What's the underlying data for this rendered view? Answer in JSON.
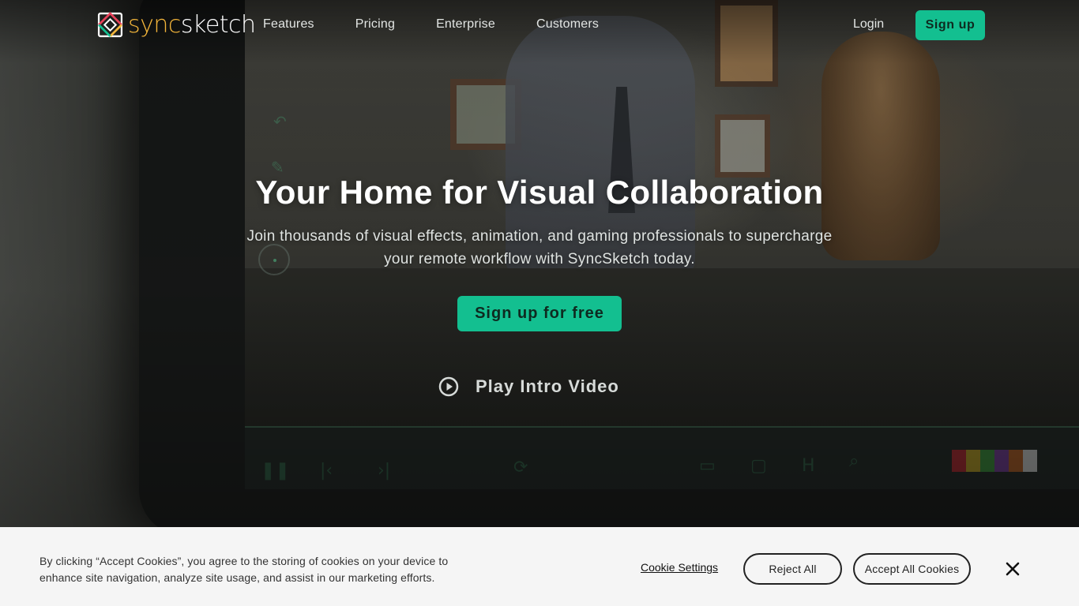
{
  "brand": {
    "name_part1": "sync",
    "name_part2": "sketch",
    "accent_color": "#13bf90",
    "logo_colors": [
      "#e8425a",
      "#f3b53a",
      "#13bf90",
      "#ffffff"
    ]
  },
  "nav": {
    "links": [
      "Features",
      "Pricing",
      "Enterprise",
      "Customers"
    ],
    "login": "Login",
    "signup": "Sign up"
  },
  "hero": {
    "title": "Your Home for Visual Collaboration",
    "subtitle": "Join thousands of visual effects, animation, and gaming professionals to supercharge your remote workflow with SyncSketch today.",
    "cta": "Sign up for free",
    "play_video": "Play Intro Video",
    "play_icon": "play-circle-icon"
  },
  "cookie_banner": {
    "message": "By clicking “Accept Cookies”, you agree to the storing of cookies on your device to enhance site navigation, analyze site usage, and assist in our marketing efforts.",
    "settings": "Cookie Settings",
    "reject": "Reject All",
    "accept": "Accept All Cookies",
    "close_icon": "close-icon"
  }
}
